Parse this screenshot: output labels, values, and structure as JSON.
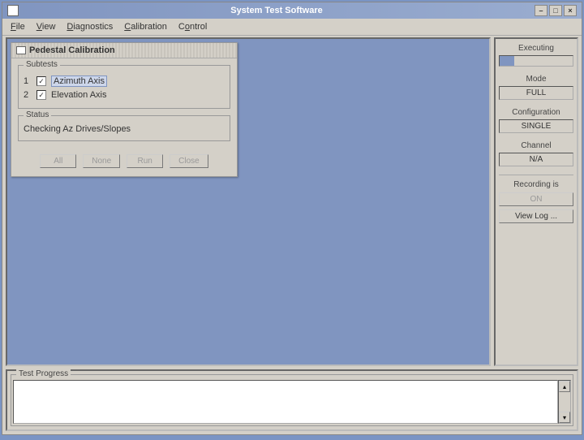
{
  "window": {
    "title": "System Test Software",
    "minimize": "–",
    "maximize": "□",
    "close": "×"
  },
  "menu": {
    "file": "File",
    "view": "View",
    "diagnostics": "Diagnostics",
    "calibration": "Calibration",
    "control": "Control"
  },
  "panel": {
    "title": "Pedestal Calibration",
    "subtests_legend": "Subtests",
    "subtest1_num": "1",
    "subtest1_label": "Azimuth Axis",
    "subtest2_num": "2",
    "subtest2_label": "Elevation Axis",
    "status_legend": "Status",
    "status_text": "Checking Az Drives/Slopes",
    "btn_all": "All",
    "btn_none": "None",
    "btn_run": "Run",
    "btn_close": "Close"
  },
  "sidebar": {
    "executing": "Executing",
    "mode_label": "Mode",
    "mode_value": "FULL",
    "config_label": "Configuration",
    "config_value": "SINGLE",
    "channel_label": "Channel",
    "channel_value": "N/A",
    "recording_label": "Recording is",
    "recording_btn": "ON",
    "viewlog_btn": "View Log ..."
  },
  "bottom": {
    "legend": "Test Progress"
  }
}
